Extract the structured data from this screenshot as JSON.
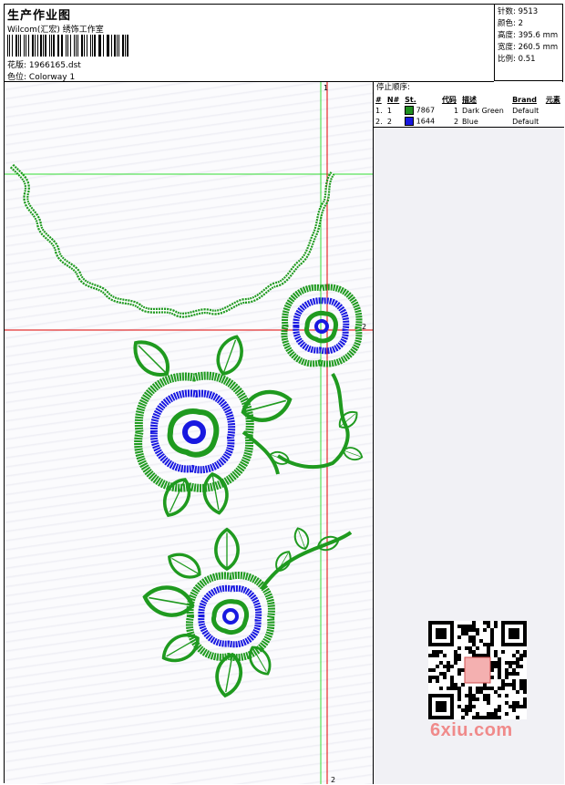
{
  "header": {
    "title": "生产作业图",
    "studio": "Wilcom(汇宏) 绣饰工作室",
    "design_label": "花版:",
    "design_file": "1966165.dst",
    "colorway_label": "色位:",
    "colorway": "Colorway 1"
  },
  "stats": [
    {
      "label": "针数:",
      "value": "9513"
    },
    {
      "label": "颜色:",
      "value": "2"
    },
    {
      "label": "高度:",
      "value": "395.6 mm"
    },
    {
      "label": "宽度:",
      "value": "260.5 mm"
    },
    {
      "label": "比例:",
      "value": "0.51"
    }
  ],
  "stop_sequence": {
    "title": "停止顺序:",
    "columns": [
      "#",
      "N#",
      "St.",
      "代码",
      "描述",
      "Brand",
      "元素"
    ],
    "rows": [
      {
        "idx": "1.",
        "n": "1",
        "color": "#1f8f1f",
        "stitches": "7867",
        "code": "1",
        "desc": "Dark Green",
        "brand": "Default",
        "element": ""
      },
      {
        "idx": "2.",
        "n": "2",
        "color": "#1818e0",
        "stitches": "1644",
        "code": "2",
        "desc": "Blue",
        "brand": "Default",
        "element": ""
      }
    ]
  },
  "canvas": {
    "axis_marks": {
      "top": "1",
      "right": "2",
      "bottom": "2"
    },
    "colors": {
      "green": "#1f9a1f",
      "blue": "#1818e0",
      "red": "#e00000",
      "guide_green": "#33dd33"
    }
  },
  "watermark": "6xiu.com"
}
